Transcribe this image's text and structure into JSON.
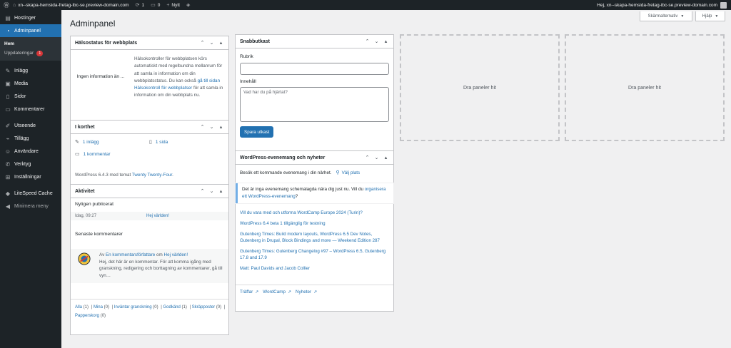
{
  "adminbar": {
    "site_name": "xn--skapa-hemsida-fretag-ibc-se.preview-domain.com",
    "updates_count": "1",
    "comments_count": "0",
    "new_label": "Nytt",
    "greeting": "Hej, xn--skapa-hemsida-fretag-ibc-se.preview-domain.com"
  },
  "sidebar": {
    "hosting": "Hostinger",
    "adminpanel": "Adminpanel",
    "sub_home": "Hem",
    "sub_updates": "Uppdateringar",
    "updates_badge": "1",
    "posts": "Inlägg",
    "media": "Media",
    "pages": "Sidor",
    "comments": "Kommentarer",
    "appearance": "Utseende",
    "plugins": "Tillägg",
    "users": "Användare",
    "tools": "Verktyg",
    "settings": "Inställningar",
    "litespeed": "LiteSpeed Cache",
    "collapse": "Minimera meny"
  },
  "header": {
    "title": "Adminpanel",
    "screen_options": "Skärmalternativ",
    "help": "Hjälp"
  },
  "health": {
    "title": "Hälsostatus för webbplats",
    "no_info": "Ingen information än ...",
    "desc_1": "Hälsokontroller för webbplatsen körs automatiskt med regelbundna mellanrum för att samla in information om din webbplatsstatus. Du kan också ",
    "desc_link": "gå till sidan Hälsokontroll för webbplatser",
    "desc_2": " för att samla in information om din webbplats nu."
  },
  "glance": {
    "title": "I korthet",
    "posts": "1 inlägg",
    "pages": "1 sida",
    "comments": "1 kommentar",
    "footer_1": "WordPress 6.4.3 med temat ",
    "theme_link": "Twenty Twenty-Four",
    "footer_2": "."
  },
  "activity": {
    "title": "Aktivitet",
    "recent_published": "Nyligen publicerat",
    "post_date": "Idag, 09:27",
    "post_title": "Hej världen!",
    "recent_comments": "Senaste kommentarer",
    "comment_from": "Av ",
    "comment_author": "En kommentarsförfattare",
    "comment_on": " om ",
    "comment_post": "Hej världen!",
    "comment_body": "Hej, det här är en kommentar. För att komma igång med granskning, redigering och borttagning av kommentarer, gå till vyn…",
    "links": [
      {
        "label": "Alla",
        "count": "(1)"
      },
      {
        "label": "Mina",
        "count": "(0)"
      },
      {
        "label": "Inväntar granskning",
        "count": "(0)"
      },
      {
        "label": "Godkänd",
        "count": "(1)"
      },
      {
        "label": "Skräpposter",
        "count": "(0)"
      },
      {
        "label": "Papperskorg",
        "count": "(0)"
      }
    ]
  },
  "quickdraft": {
    "title": "Snabbutkast",
    "title_label": "Rubrik",
    "content_label": "Innehåll",
    "content_placeholder": "Vad har du på hjärtat?",
    "save_label": "Spara utkast"
  },
  "events": {
    "title": "WordPress-evenemang och nyheter",
    "intro": "Besök ett kommande evenemang i din närhet.",
    "select_location": "Välj plats",
    "notice_1": "Det är inga evenemang schemalagda nära dig just nu. Vill du ",
    "notice_link": "organisera ett WordPress-evenemang",
    "notice_2": "?",
    "news": [
      "Vill du vara med och utforma WordCamp Europe 2024 (Turin)?",
      "WordPress 6.4 beta 1 tillgänglig för testning",
      "Gutenberg Times: Build modern layouts, WordPress 6.5 Dev Notes, Gutenberg in Drupal, Block Bindings and more — Weekend Edition 287",
      "Gutenberg Times: Gutenberg Changelog #97 – WordPress 6.5, Gutenberg 17.8 and 17.9",
      "Matt: Paul Davids and Jacob Collier"
    ],
    "footer_links": [
      "Träffar",
      "WordCamp",
      "Nyheter"
    ]
  },
  "dropzones": {
    "label_1": "Dra paneler hit",
    "label_2": "Dra paneler hit"
  }
}
